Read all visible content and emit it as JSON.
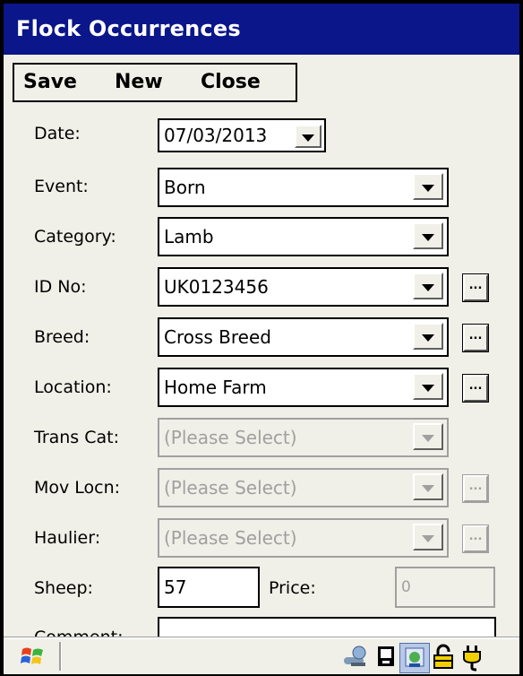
{
  "title": "Flock Occurrences",
  "menu": {
    "save": "Save",
    "new": "New",
    "close": "Close"
  },
  "date": {
    "label": "Date:",
    "value": "07/03/2013"
  },
  "event": {
    "label": "Event:",
    "value": "Born"
  },
  "category": {
    "label": "Category:",
    "value": "Lamb"
  },
  "id_no": {
    "label": "ID No:",
    "value": "UK0123456"
  },
  "breed": {
    "label": "Breed:",
    "value": "Cross Breed"
  },
  "location": {
    "label": "Location:",
    "value": "Home Farm"
  },
  "trans_cat": {
    "label": "Trans Cat:",
    "value": "(Please Select)"
  },
  "mov_locn": {
    "label": "Mov Locn:",
    "value": "(Please Select)"
  },
  "haulier": {
    "label": "Haulier:",
    "value": "(Please Select)"
  },
  "sheep": {
    "label": "Sheep:",
    "value": "57"
  },
  "price": {
    "label": "Price:",
    "value": "0"
  },
  "comment": {
    "label": "Comment:",
    "value": ""
  },
  "browse_label": "...",
  "colors": {
    "titlebar": "#0a1689",
    "background": "#f0f0e8",
    "disabled": "#a0a0a0"
  },
  "taskbar": {
    "icons": [
      "start-flag-icon",
      "network-icon",
      "pda-icon",
      "sync-icon",
      "lock-icon",
      "power-plug-icon"
    ]
  }
}
